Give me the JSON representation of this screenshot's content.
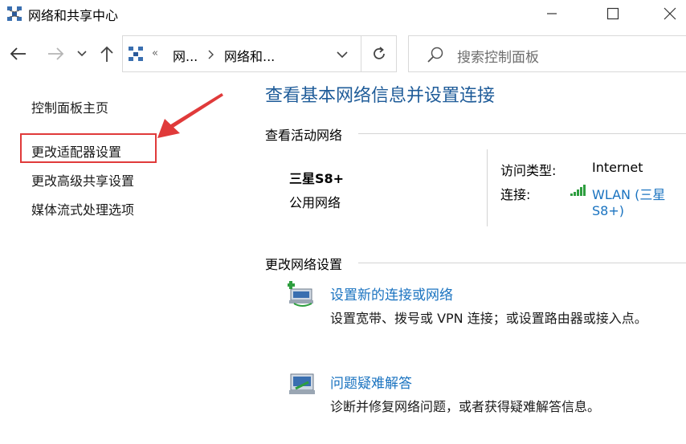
{
  "window": {
    "title": "网络和共享中心",
    "controls": [
      "minimize",
      "maximize",
      "close"
    ]
  },
  "navigation": {
    "breadcrumb_overflow": "«",
    "breadcrumbs": [
      "网...",
      "网络和..."
    ],
    "search_placeholder": "搜索控制面板"
  },
  "sidebar": {
    "items": [
      {
        "label": "控制面板主页"
      },
      {
        "label": "更改适配器设置",
        "highlighted": true
      },
      {
        "label": "更改高级共享设置"
      },
      {
        "label": "媒体流式处理选项"
      }
    ],
    "annotation_color": "#e03a3a"
  },
  "main": {
    "title": "查看基本网络信息并设置连接",
    "active_networks": {
      "heading": "查看活动网络",
      "network_name": "三星S8+",
      "network_category": "公用网络",
      "access_type_label": "访问类型:",
      "access_type_value": "Internet",
      "connection_label": "连接:",
      "connection_value_line1": "WLAN (三星",
      "connection_value_line2": "S8+)"
    },
    "change_settings": {
      "heading": "更改网络设置",
      "tasks": [
        {
          "icon": "new-connection-icon",
          "title": "设置新的连接或网络",
          "description": "设置宽带、拨号或 VPN 连接；或设置路由器或接入点。"
        },
        {
          "icon": "troubleshoot-icon",
          "title": "问题疑难解答",
          "description": "诊断并修复网络问题，或者获得疑难解答信息。"
        }
      ]
    }
  },
  "colors": {
    "title_blue": "#1f5c99",
    "link_blue": "#1a73c0",
    "signal_green": "#2e9e3f"
  }
}
